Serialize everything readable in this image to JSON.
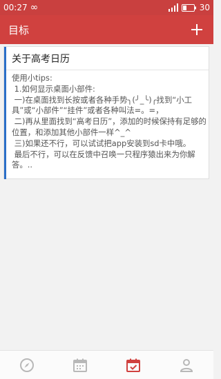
{
  "status_bar": {
    "time": "00:27",
    "infinity_icon": "∞",
    "battery": "30"
  },
  "app_bar": {
    "title": "目标"
  },
  "card": {
    "title": "关于高考日历",
    "body": "使用小tips:\n 1.如何显示桌面小部件:\n 一)在桌面找到长按或者各种手势╮(╯_╰)╭找到“小工具”或“小部件”“挂件”或者各种叫法=。=，\n 二)再从里面找到“高考日历”，添加的时候保持有足够的位置，和添加其他小部件一样^_^\n 三)如果还不行，可以试试把app安装到sd卡中哦。\n 最后不行，可以在反馈中召唤一只程序猿出来为你解答。.."
  },
  "bottom_nav": {
    "items": [
      "compass-icon",
      "calendar-icon",
      "calendar-check-icon",
      "person-icon"
    ],
    "active_index": 2,
    "active_color": "#d0413f",
    "inactive_color": "#b8b8b8"
  }
}
